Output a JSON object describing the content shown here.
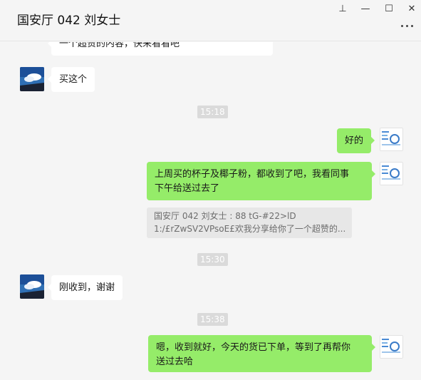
{
  "header": {
    "chat_title": "国安厅 042 刘女士"
  },
  "window_controls": {
    "pin": "⊥",
    "minimize": "—",
    "maximize": "☐",
    "close": "✕"
  },
  "messages": {
    "m0": {
      "text": "一个超赞的内容，快来看看吧"
    },
    "m1": {
      "text": "买这个"
    },
    "t1": {
      "text": "15:18"
    },
    "m2": {
      "text": "好的"
    },
    "m3": {
      "line1": "上周买的杯子及椰子粉，都收到了吧，我看同事",
      "line2": "下午给送过去了"
    },
    "quote": {
      "line1": "国安厅 042 刘女士 : 88 tG-#22>lD",
      "line2": "1:/£rZwSV2VPsoE£欢我分享给你了一个超赞的..."
    },
    "t2": {
      "text": "15:30"
    },
    "m4": {
      "text": "刚收到，谢谢"
    },
    "t3": {
      "text": "15:38"
    },
    "m5": {
      "line1": "嗯，收到就好，今天的货已下单，等到了再帮你",
      "line2": "送过去哈"
    }
  },
  "icons": [
    "pin-icon",
    "minimize-icon",
    "maximize-icon",
    "close-icon",
    "more-icon",
    "contact-avatar",
    "self-avatar"
  ],
  "colors": {
    "sent_bubble": "#95ec69",
    "received_bubble": "#ffffff",
    "background": "#f5f5f5",
    "timestamp_bg": "#dadada"
  }
}
